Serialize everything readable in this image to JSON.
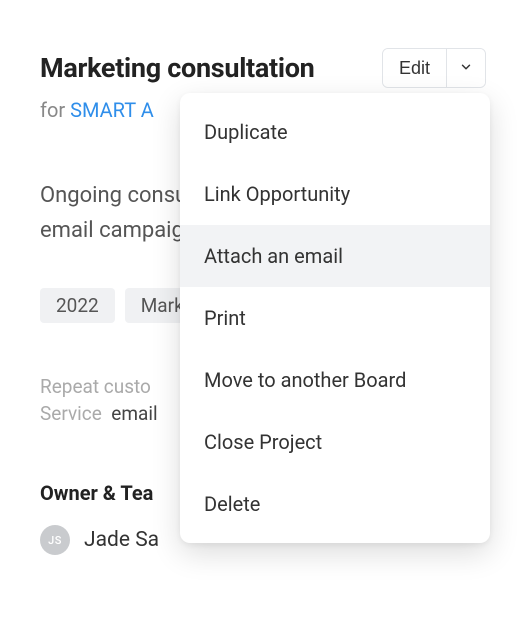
{
  "header": {
    "title": "Marketing consultation",
    "edit_label": "Edit"
  },
  "subline": {
    "for_label": "for ",
    "company_link": "SMART A"
  },
  "description": "Ongoing consultation and management of email campaigns",
  "tags": [
    "2022",
    "Mark"
  ],
  "meta": {
    "repeat_label": "Repeat custo",
    "service_label": "Service",
    "service_value": "email"
  },
  "owner": {
    "heading": "Owner & Tea",
    "avatar_initials": "JS",
    "name": "Jade Sa"
  },
  "menu": {
    "items": [
      {
        "label": "Duplicate",
        "hovered": false
      },
      {
        "label": "Link Opportunity",
        "hovered": false
      },
      {
        "label": "Attach an email",
        "hovered": true
      },
      {
        "label": "Print",
        "hovered": false
      },
      {
        "label": "Move to another Board",
        "hovered": false
      },
      {
        "label": "Close Project",
        "hovered": false
      },
      {
        "label": "Delete",
        "hovered": false
      }
    ]
  }
}
